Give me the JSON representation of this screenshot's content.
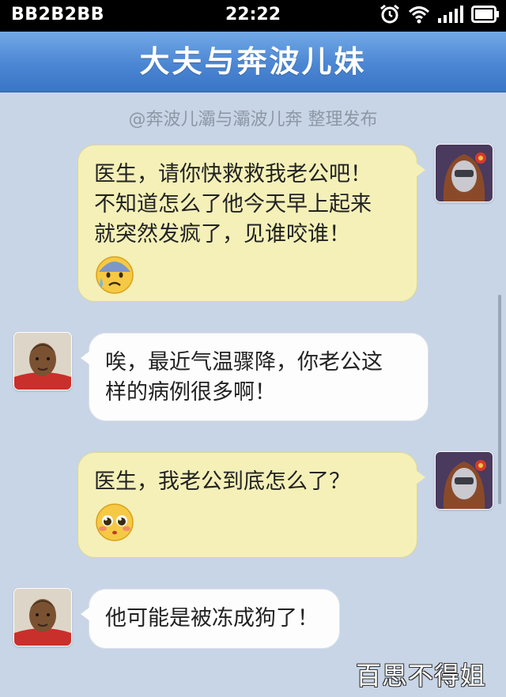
{
  "status_bar": {
    "carrier": "BB2B2BB",
    "time": "22:22",
    "icons": [
      "alarm-icon",
      "wifi-icon",
      "signal-icon",
      "battery-icon"
    ]
  },
  "header": {
    "title": "大夫与奔波儿妹"
  },
  "credit": "@奔波儿灞与灞波儿奔 整理发布",
  "messages": [
    {
      "sender": "wife",
      "side": "right",
      "lines": [
        "医生，请你快救救我老公吧！",
        "不知道怎么了他今天早上起来",
        "就突然发疯了，见谁咬谁！"
      ],
      "emoji": "anxious-sweat-face"
    },
    {
      "sender": "doctor",
      "side": "left",
      "lines": [
        "唉，最近气温骤降，你老公这",
        "样的病例很多啊！"
      ]
    },
    {
      "sender": "wife",
      "side": "right",
      "lines": [
        "医生，我老公到底怎么了？"
      ],
      "emoji": "pleading-face"
    },
    {
      "sender": "doctor",
      "side": "left",
      "lines": [
        "他可能是被冻成狗了！"
      ]
    }
  ],
  "watermark": "百思不得姐",
  "colors": {
    "header_top": "#73a9e7",
    "header_bottom": "#3a75c6",
    "background": "#c8d5e6",
    "bubble_yellow": "#f4f0b8",
    "bubble_white": "#fdfdfd"
  }
}
